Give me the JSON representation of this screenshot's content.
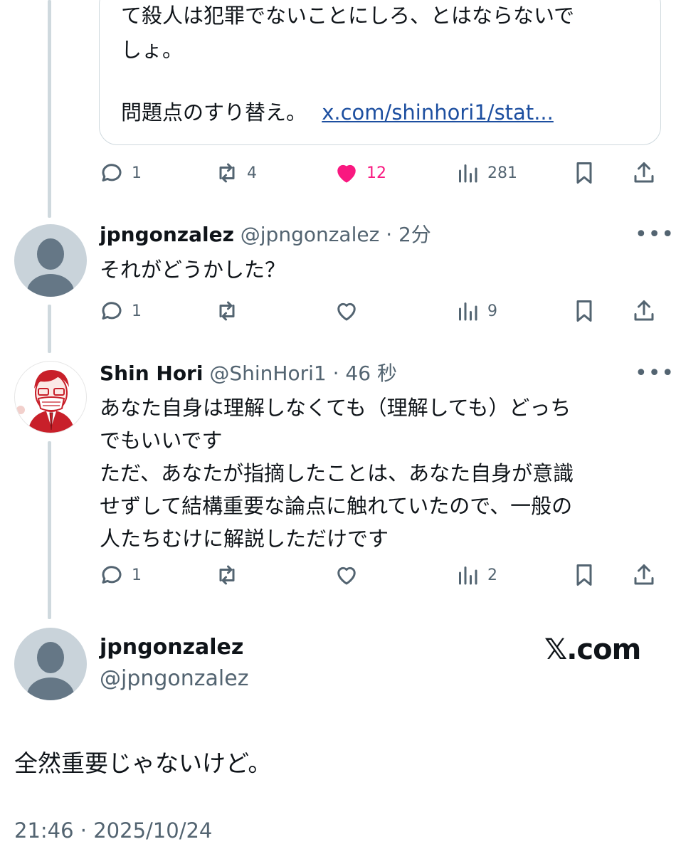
{
  "quoted_tweet": {
    "lines": [
      "て殺人は犯罪でないことにしろ、とはならないで",
      "しょ。",
      ""
    ],
    "last_line_text": "問題点のすり替え。",
    "link_text": "x.com/shinhori1/stat..."
  },
  "parent_actions": {
    "replies": "1",
    "retweets": "4",
    "likes": "12",
    "views": "281"
  },
  "replies": [
    {
      "name": "jpngonzalez",
      "meta": "@jpngonzalez · 2分",
      "lines": [
        "それがどうかした？"
      ],
      "actions": {
        "replies": "1",
        "retweets": "",
        "likes": "",
        "views": "9"
      }
    },
    {
      "name": "Shin Hori",
      "meta": "@ShinHori1 · 46 秒",
      "lines": [
        "あなた自身は理解しなくても（理解しても）どっち",
        "でもいいです",
        "ただ、あなたが指摘したことは、あなた自身が意識",
        "せずして結構重要な論点に触れていたので、一般の",
        "人たちむけに解説しただけです"
      ],
      "actions": {
        "replies": "1",
        "retweets": "",
        "likes": "",
        "views": "2"
      }
    }
  ],
  "main_tweet": {
    "name": "jpngonzalez",
    "handle": "@jpngonzalez",
    "brand": "𝕏.com",
    "text": "全然重要じゃないけど。",
    "timestamp": "21:46 · 2025/10/24"
  },
  "more_label": "•••",
  "colors": {
    "like": "#f91880",
    "muted": "#536471",
    "link": "#1d4fa0",
    "line": "#cfd9de"
  }
}
